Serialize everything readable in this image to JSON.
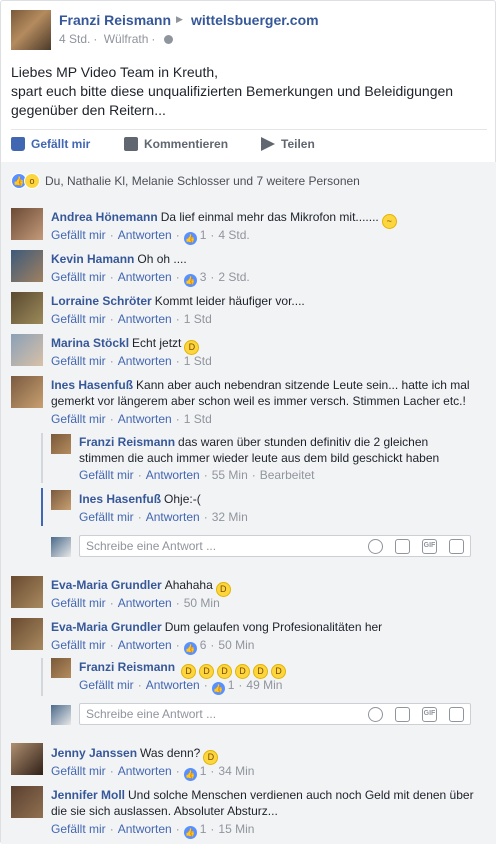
{
  "post": {
    "author": "Franzi Reismann",
    "page": "wittelsbuerger.com",
    "time": "4 Std.",
    "location": "Wülfrath",
    "text": "Liebes MP Video Team in Kreuth,\nspart euch bitte diese unqualifizierten Bemerkungen und Beleidigungen gegenüber den Reitern..."
  },
  "actions": {
    "like": "Gefällt mir",
    "comment": "Kommentieren",
    "share": "Teilen"
  },
  "reactions": {
    "summary": "Du, Nathalie Kl, Melanie Schlosser und 7 weitere Personen"
  },
  "labels": {
    "like": "Gefällt mir",
    "reply": "Antworten",
    "reply_placeholder": "Schreibe eine Antwort ..."
  },
  "comments": [
    {
      "name": "Andrea Hönemann",
      "text": "Da lief einmal mehr das Mikrofon mit.......",
      "likes": "1",
      "time": "4 Std."
    },
    {
      "name": "Kevin Hamann",
      "text": "Oh oh ....",
      "likes": "3",
      "time": "2 Std."
    },
    {
      "name": "Lorraine Schröter",
      "text": "Kommt leider häufiger vor....",
      "time": "1 Std"
    },
    {
      "name": "Marina Stöckl",
      "text": "Echt jetzt",
      "time": "1 Std"
    },
    {
      "name": "Ines Hasenfuß",
      "text": "Kann aber auch nebendran sitzende Leute sein... hatte ich mal gemerkt vor längerem aber schon weil es immer versch. Stimmen Lacher etc.!",
      "time": "1 Std"
    },
    {
      "name": "Eva-Maria Grundler",
      "text": "Ahahaha",
      "time": "50 Min"
    },
    {
      "name": "Eva-Maria Grundler",
      "text": "Dum gelaufen vong Profesionalitäten her",
      "likes": "6",
      "time": "50 Min"
    },
    {
      "name": "Jenny Janssen",
      "text": "Was denn?",
      "likes": "1",
      "time": "34 Min"
    },
    {
      "name": "Jennifer Moll",
      "text": "Und solche Menschen verdienen auch noch Geld mit denen über die sie sich auslassen. Absoluter Absturz...",
      "likes": "1",
      "time": "15 Min"
    }
  ],
  "replies": [
    {
      "name": "Franzi Reismann",
      "text": "das waren über stunden definitiv die 2 gleichen stimmen die auch immer wieder leute aus dem bild geschickt haben",
      "time": "55 Min",
      "extra": "Bearbeitet"
    },
    {
      "name": "Ines Hasenfuß",
      "text": "Ohje:-(",
      "time": "32 Min"
    },
    {
      "name": "Franzi Reismann",
      "text": "",
      "likes": "1",
      "time": "49 Min"
    }
  ],
  "colors": {
    "link": "#365899",
    "accent": "#4267b2",
    "muted": "#90949c",
    "background": "#f2f3f5"
  }
}
